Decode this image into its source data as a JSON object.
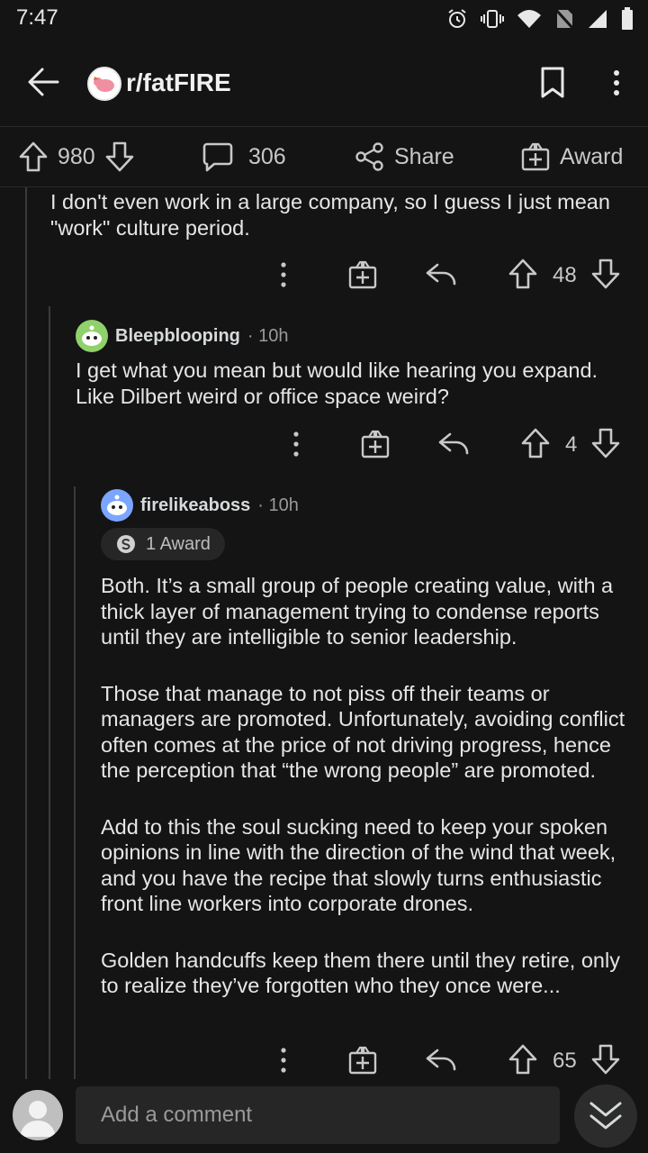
{
  "status_bar": {
    "time": "7:47"
  },
  "header": {
    "subreddit": "r/fatFIRE"
  },
  "post_actions": {
    "score": "980",
    "comments": "306",
    "share_label": "Share",
    "award_label": "Award"
  },
  "comments": [
    {
      "text": "I don't even work in a large company, so I guess I just mean \"work\" culture period.",
      "score": "48"
    },
    {
      "author": "Bleepblooping",
      "time": "· 10h",
      "text": "I get what you mean but would like hearing you expand. Like Dilbert weird or office space weird?",
      "score": "4"
    },
    {
      "author": "firelikeaboss",
      "time": "· 10h",
      "award": "1 Award",
      "paragraphs": [
        "Both.  It’s a small group of people creating value, with a thick layer of management trying to condense reports until they are intelligible to senior leadership.",
        "Those that manage to not piss off their teams or managers are promoted.  Unfortunately, avoiding conflict often comes at the price of not driving progress, hence the perception that “the wrong people” are promoted.",
        "Add to this the soul sucking need to keep your spoken opinions in line with the direction of the wind that week, and you have the recipe that slowly turns enthusiastic front line workers into corporate drones.",
        "Golden handcuffs keep them there until they retire, only to realize they’ve forgotten who they once were..."
      ],
      "score": "65"
    }
  ],
  "bottom_bar": {
    "placeholder": "Add a comment"
  },
  "icons": {
    "upvote": "arrow-up-icon",
    "downvote": "arrow-down-icon",
    "reply": "reply-icon",
    "award": "gift-icon",
    "more": "more-vertical-icon"
  }
}
